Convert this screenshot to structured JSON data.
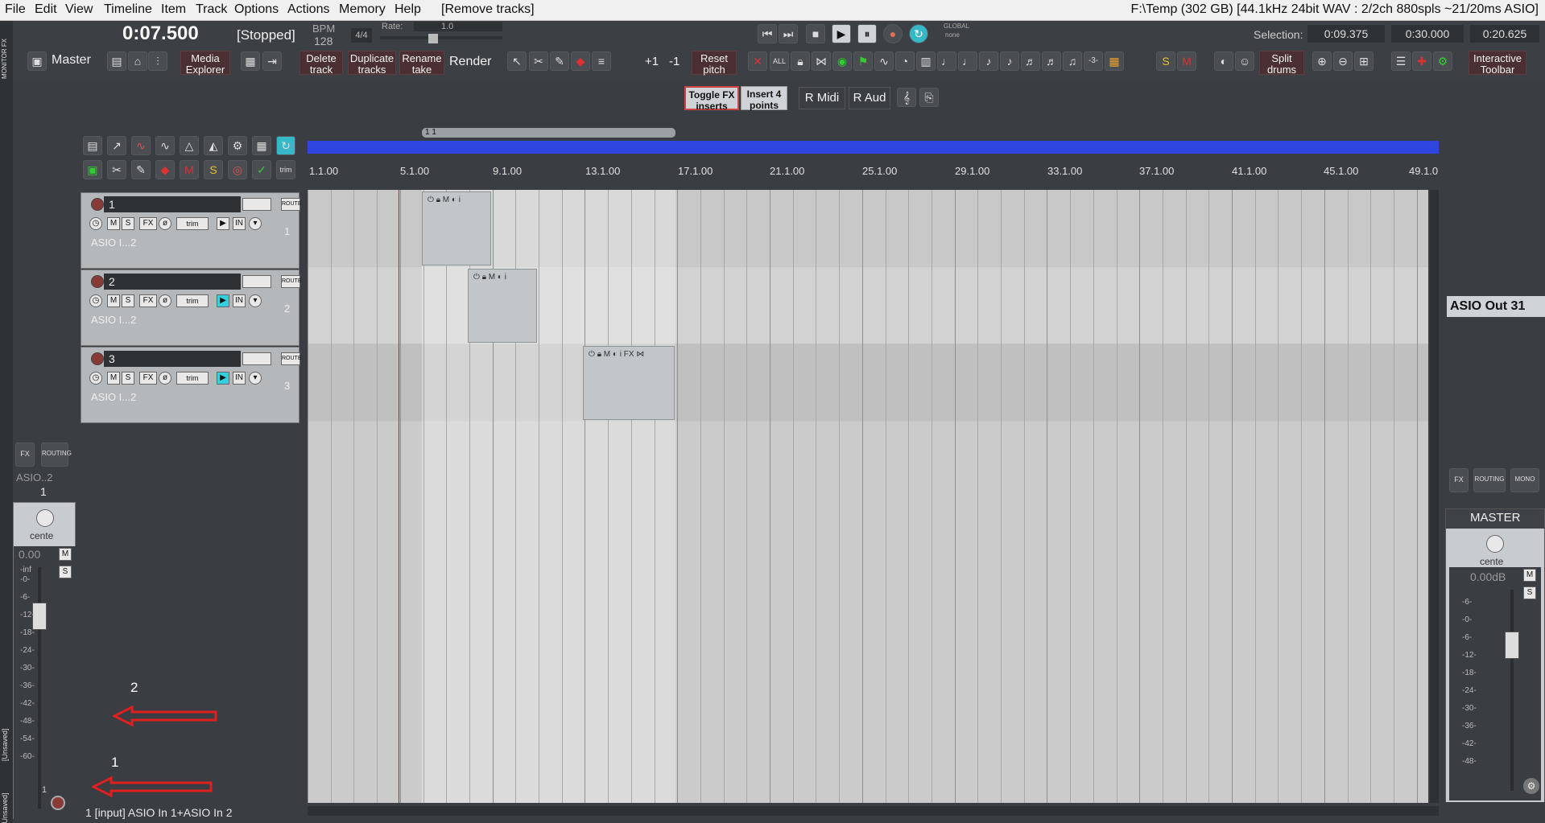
{
  "menu": {
    "items": [
      "File",
      "Edit",
      "View",
      "Timeline",
      "Item",
      "Track",
      "Options",
      "Actions",
      "Memory",
      "Help",
      "[Remove tracks]"
    ],
    "status": "F:\\Temp (302 GB) [44.1kHz 24bit WAV : 2/2ch 880spls ~21/20ms ASIO]"
  },
  "transport": {
    "time": "0:07.500",
    "state": "[Stopped]",
    "bpm_label": "BPM",
    "bpm": "128",
    "timesig": "4/4",
    "rate_label": "Rate:",
    "rate": "1.0",
    "global_label": "GLOBAL",
    "global_value": "none",
    "selection_label": "Selection:",
    "sel_start": "0:09.375",
    "sel_end": "0:30.000",
    "sel_len": "0:20.625"
  },
  "toolbar": {
    "master": "Master",
    "media_explorer": "Media Explorer",
    "delete_track": "Delete track",
    "duplicate_tracks": "Duplicate tracks",
    "rename_take": "Rename take",
    "render": "Render",
    "plus1": "+1",
    "minus1": "-1",
    "reset_pitch": "Reset pitch",
    "split_drums": "Split drums",
    "interactive_toolbar": "Interactive Toolbar"
  },
  "toolbar2": {
    "toggle_fx": "Toggle FX inserts",
    "insert4": "Insert 4 points",
    "r_midi": "R Midi",
    "r_aud": "R Aud"
  },
  "ruler": {
    "region_label": "1  1",
    "ticks": [
      "1.1.00",
      "5.1.00",
      "9.1.00",
      "13.1.00",
      "17.1.00",
      "21.1.00",
      "25.1.00",
      "29.1.00",
      "33.1.00",
      "37.1.00",
      "41.1.00",
      "45.1.00",
      "49.1.0"
    ]
  },
  "tracks": [
    {
      "num": "1",
      "name": "1",
      "io": "ASIO I...2"
    },
    {
      "num": "2",
      "name": "2",
      "io": "ASIO I...2"
    },
    {
      "num": "3",
      "name": "3",
      "io": "ASIO I...2"
    }
  ],
  "mixer_left": {
    "io": "ASIO..2",
    "track_num": "1",
    "pan": "cente",
    "vol": "0.00",
    "bottom_num": "1",
    "db_scale": [
      "-inf",
      "-0-",
      "-6-",
      "-12-",
      "-18-",
      "-24-",
      "-30-",
      "-36-",
      "-42-",
      "-48-",
      "-54-",
      "-60-"
    ]
  },
  "mixer_right": {
    "asio_out": "ASIO Out 31",
    "master_label": "MASTER",
    "pan": "cente",
    "vol": "0.00dB",
    "db_scale": [
      "-6-",
      "-0-",
      "-6-",
      "-12-",
      "-18-",
      "-24-",
      "-30-",
      "-36-",
      "-42-",
      "-48-"
    ]
  },
  "status_bar": "1 [input] ASIO In 1+ASIO In 2",
  "annotations": [
    "2",
    "1"
  ],
  "side_labels": {
    "monitor_fx": "MONITOR FX",
    "unsaved": "[Unsaved]"
  },
  "colors": {
    "loop": "#2e45e0",
    "arrow": "#e02020",
    "bg": "#3a3d41"
  }
}
